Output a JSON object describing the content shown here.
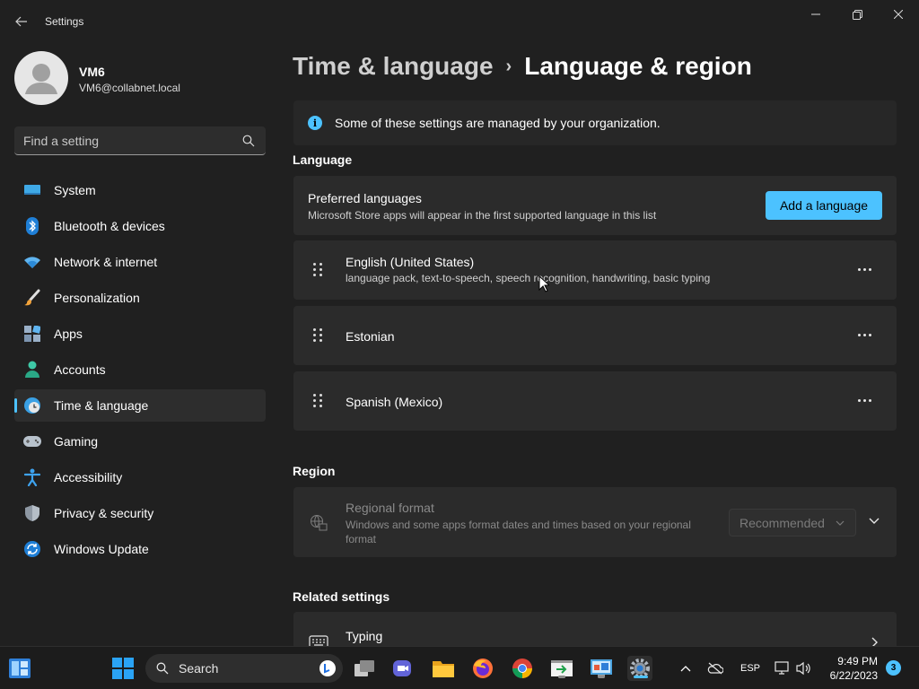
{
  "window": {
    "app_title": "Settings",
    "back_icon": "arrow-left-icon",
    "controls": [
      "minimize-icon",
      "maximize-icon",
      "close-icon"
    ]
  },
  "profile": {
    "name": "VM6",
    "email": "VM6@collabnet.local"
  },
  "search": {
    "placeholder": "Find a setting"
  },
  "sidebar": {
    "items": [
      {
        "label": "System",
        "icon": "monitor-icon",
        "active": false
      },
      {
        "label": "Bluetooth & devices",
        "icon": "bluetooth-icon",
        "active": false
      },
      {
        "label": "Network & internet",
        "icon": "wifi-icon",
        "active": false
      },
      {
        "label": "Personalization",
        "icon": "paintbrush-icon",
        "active": false
      },
      {
        "label": "Apps",
        "icon": "apps-icon",
        "active": false
      },
      {
        "label": "Accounts",
        "icon": "person-icon",
        "active": false
      },
      {
        "label": "Time & language",
        "icon": "globe-clock-icon",
        "active": true
      },
      {
        "label": "Gaming",
        "icon": "gamepad-icon",
        "active": false
      },
      {
        "label": "Accessibility",
        "icon": "accessibility-icon",
        "active": false
      },
      {
        "label": "Privacy & security",
        "icon": "shield-icon",
        "active": false
      },
      {
        "label": "Windows Update",
        "icon": "update-icon",
        "active": false
      }
    ]
  },
  "breadcrumb": {
    "parent": "Time & language",
    "separator": "›",
    "current": "Language & region"
  },
  "info_banner": {
    "text": "Some of these settings are managed by your organization."
  },
  "language_section": {
    "title": "Language",
    "preferred": {
      "title": "Preferred languages",
      "subtitle": "Microsoft Store apps will appear in the first supported language in this list",
      "add_button": "Add a language"
    },
    "languages": [
      {
        "name": "English (United States)",
        "features": "language pack, text-to-speech, speech recognition, handwriting, basic typing"
      },
      {
        "name": "Estonian",
        "features": ""
      },
      {
        "name": "Spanish (Mexico)",
        "features": ""
      }
    ]
  },
  "region_section": {
    "title": "Region",
    "regional_format": {
      "title": "Regional format",
      "subtitle": "Windows and some apps format dates and times based on your regional format",
      "selected": "Recommended",
      "enabled": false
    }
  },
  "related_section": {
    "title": "Related settings",
    "items": [
      {
        "label": "Typing"
      }
    ]
  },
  "taskbar": {
    "search_label": "Search",
    "language_indicator": "ESP",
    "time": "9:49 PM",
    "date": "6/22/2023",
    "notification_count": "3"
  },
  "colors": {
    "accent": "#4cc2ff",
    "background": "#202020",
    "card": "#2b2b2b"
  }
}
